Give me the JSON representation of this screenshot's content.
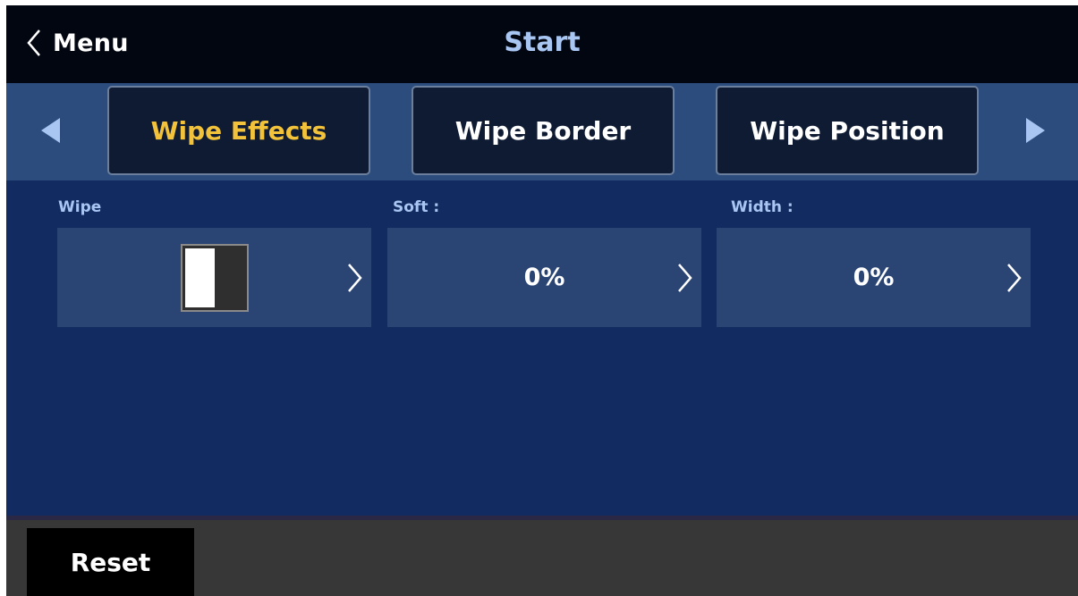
{
  "header": {
    "back_label": "Menu",
    "back_icon": "chevron-left-icon",
    "title": "Start"
  },
  "tabs": {
    "prev_icon": "triangle-left-icon",
    "next_icon": "triangle-right-icon",
    "items": [
      {
        "label": "Wipe Effects",
        "active": true
      },
      {
        "label": "Wipe Border",
        "active": false
      },
      {
        "label": "Wipe Position",
        "active": false
      }
    ]
  },
  "fields": [
    {
      "label": "Wipe",
      "value": "",
      "icon": "wipe-pattern-icon"
    },
    {
      "label": "Soft :",
      "value": "0%",
      "icon": "chevron-right-icon"
    },
    {
      "label": "Width :",
      "value": "0%",
      "icon": "chevron-right-icon"
    }
  ],
  "footer": {
    "reset_label": "Reset"
  },
  "colors": {
    "header_bg": "#020611",
    "title": "#a9c6f3",
    "tab_bar_bg": "#2c4c7e",
    "tab_bg": "#0e1b33",
    "active_tab_text": "#f2c23a",
    "content_bg": "#122c61",
    "field_bg": "#2a4474",
    "arrow": "#a9c6f3",
    "footer_bg": "#373737"
  }
}
